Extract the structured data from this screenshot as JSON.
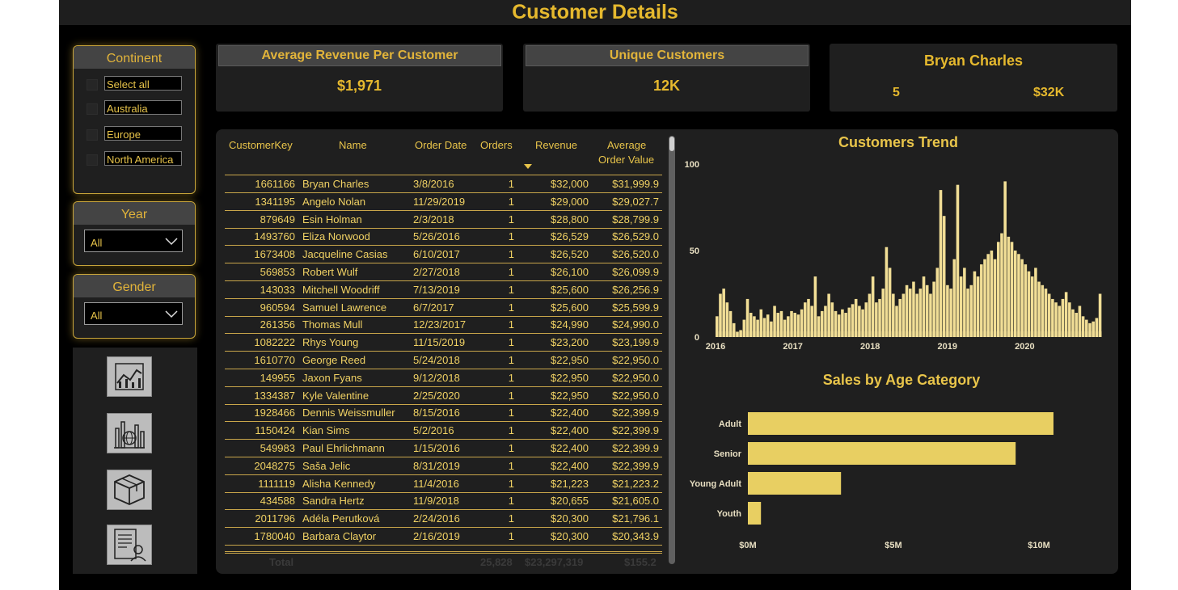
{
  "header": {
    "title": "Customer Details"
  },
  "slicers": {
    "continent": {
      "title": "Continent",
      "options": [
        "Select all",
        "Australia",
        "Europe",
        "North America"
      ]
    },
    "year": {
      "title": "Year",
      "value": "All"
    },
    "gender": {
      "title": "Gender",
      "value": "All"
    }
  },
  "nav": [
    {
      "icon": "line-chart-icon"
    },
    {
      "icon": "globe-bar-chart-icon"
    },
    {
      "icon": "box-icon"
    },
    {
      "icon": "customer-report-icon"
    }
  ],
  "cards": {
    "avg_revenue": {
      "title": "Average Revenue Per Customer",
      "value": "$1,971"
    },
    "unique_customers": {
      "title": "Unique Customers",
      "value": "12K"
    },
    "top_customer": {
      "name": "Bryan Charles",
      "orders": "5",
      "revenue": "$32K"
    }
  },
  "table": {
    "columns": [
      "CustomerKey",
      "Name",
      "Order Date",
      "Orders",
      "Revenue",
      "Average",
      "Order Value"
    ],
    "rows": [
      [
        "1661166",
        "Bryan Charles",
        "3/8/2016",
        "1",
        "$32,000",
        "$31,999.9"
      ],
      [
        "1341195",
        "Angelo Nolan",
        "11/29/2019",
        "1",
        "$29,000",
        "$29,027.7"
      ],
      [
        "879649",
        "Esin Holman",
        "2/3/2018",
        "1",
        "$28,800",
        "$28,799.9"
      ],
      [
        "1493760",
        "Eliza Norwood",
        "5/26/2016",
        "1",
        "$26,529",
        "$26,529.0"
      ],
      [
        "1673408",
        "Jacqueline Casias",
        "6/10/2017",
        "1",
        "$26,520",
        "$26,520.0"
      ],
      [
        "569853",
        "Robert Wulf",
        "2/27/2018",
        "1",
        "$26,100",
        "$26,099.9"
      ],
      [
        "143033",
        "Mitchell Woodriff",
        "7/13/2019",
        "1",
        "$25,600",
        "$26,256.9"
      ],
      [
        "960594",
        "Samuel Lawrence",
        "6/7/2017",
        "1",
        "$25,600",
        "$25,599.9"
      ],
      [
        "261356",
        "Thomas Mull",
        "12/23/2017",
        "1",
        "$24,990",
        "$24,990.0"
      ],
      [
        "1082222",
        "Rhys Young",
        "11/15/2019",
        "1",
        "$23,200",
        "$23,199.9"
      ],
      [
        "1610770",
        "George Reed",
        "5/24/2018",
        "1",
        "$22,950",
        "$22,950.0"
      ],
      [
        "149955",
        "Jaxon Fyans",
        "9/12/2018",
        "1",
        "$22,950",
        "$22,950.0"
      ],
      [
        "1334387",
        "Kyle Valentine",
        "2/25/2020",
        "1",
        "$22,950",
        "$22,950.0"
      ],
      [
        "1928466",
        "Dennis Weissmuller",
        "8/15/2016",
        "1",
        "$22,400",
        "$22,399.9"
      ],
      [
        "1150424",
        "Kian Sims",
        "5/2/2016",
        "1",
        "$22,400",
        "$22,399.9"
      ],
      [
        "549983",
        "Paul Ehrlichmann",
        "1/15/2016",
        "1",
        "$22,400",
        "$22,399.9"
      ],
      [
        "2048275",
        "Saša Jelic",
        "8/31/2019",
        "1",
        "$22,400",
        "$22,399.9"
      ],
      [
        "1111119",
        "Alisha Kennedy",
        "11/4/2016",
        "1",
        "$21,223",
        "$21,223.2"
      ],
      [
        "434588",
        "Sandra Hertz",
        "11/9/2018",
        "1",
        "$20,655",
        "$21,605.0"
      ],
      [
        "2011796",
        "Adéla Perutková",
        "2/24/2016",
        "1",
        "$20,300",
        "$21,796.1"
      ],
      [
        "1780040",
        "Barbara Claytor",
        "2/16/2019",
        "1",
        "$20,300",
        "$20,343.9"
      ]
    ],
    "total": {
      "label": "Total",
      "orders": "25,828",
      "revenue": "$23,297,319",
      "avg": "$155.2"
    }
  },
  "chart_data": [
    {
      "type": "bar",
      "title": "Customers Trend",
      "x_ticks": [
        "2016",
        "2017",
        "2018",
        "2019",
        "2020"
      ],
      "y_ticks": [
        "0",
        "50",
        "100"
      ],
      "ylim": [
        0,
        100
      ],
      "x_start": 2016,
      "x_end": 2021,
      "values": [
        12,
        25,
        28,
        20,
        15,
        8,
        3,
        4,
        10,
        22,
        14,
        12,
        10,
        16,
        11,
        13,
        9,
        18,
        14,
        15,
        10,
        12,
        15,
        14,
        13,
        16,
        20,
        22,
        18,
        35,
        12,
        15,
        18,
        25,
        20,
        15,
        13,
        16,
        14,
        17,
        19,
        22,
        18,
        16,
        20,
        25,
        35,
        20,
        22,
        28,
        52,
        40,
        25,
        18,
        22,
        25,
        30,
        28,
        32,
        25,
        28,
        35,
        30,
        25,
        32,
        40,
        85,
        70,
        30,
        28,
        45,
        88,
        35,
        40,
        28,
        30,
        38,
        35,
        42,
        45,
        48,
        50,
        45,
        55,
        60,
        90,
        58,
        55,
        50,
        48,
        45,
        42,
        38,
        35,
        40,
        32,
        30,
        28,
        25,
        22,
        20,
        18,
        22,
        26,
        20,
        16,
        14,
        18,
        12,
        10,
        8,
        9,
        11,
        25
      ],
      "color": "#f1de96"
    },
    {
      "type": "bar",
      "orientation": "horizontal",
      "title": "Sales by Age Category",
      "categories": [
        "Adult",
        "Senior",
        "Young Adult",
        "Youth"
      ],
      "values": [
        10.5,
        9.2,
        3.2,
        0.45
      ],
      "x_ticks": [
        "$0M",
        "$5M",
        "$10M"
      ],
      "xlim": [
        0,
        10.5
      ],
      "color": "#e8cf62"
    }
  ],
  "colors": {
    "accent": "#e6b92e",
    "panel": "#1f1f1f",
    "background": "#000000"
  }
}
